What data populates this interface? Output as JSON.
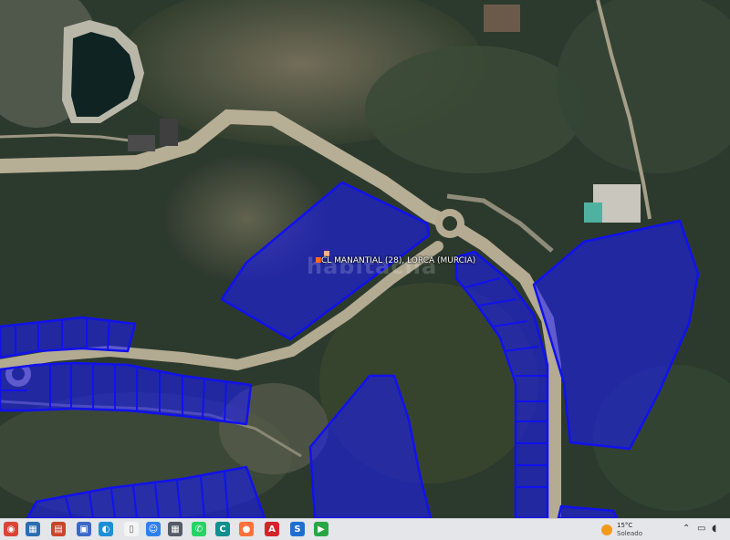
{
  "map": {
    "plot_label": "CL MANANTIAL (28), LORCA (MURCIA)",
    "watermark": "habitaclia",
    "overlay_color": "#1a1aff",
    "overlay_stroke": "#1111ee",
    "marker_colors": [
      "#ff6a1a",
      "#ffb089"
    ]
  },
  "taskbar": {
    "icons": [
      {
        "name": "chrome-icon",
        "color": "#db4437",
        "glyph": "◉"
      },
      {
        "name": "calendar-icon",
        "color": "#2b6cb0",
        "glyph": "▦"
      },
      {
        "name": "slides-icon",
        "color": "#c8462c",
        "glyph": "▤"
      },
      {
        "name": "teams-icon",
        "color": "#3a68c7",
        "glyph": "▣"
      },
      {
        "name": "edge-icon",
        "color": "#1d8fd6",
        "glyph": "◐"
      },
      {
        "name": "file-icon",
        "color": "#f4f4f4",
        "glyph": "▯"
      },
      {
        "name": "finder-icon",
        "color": "#2f80ed",
        "glyph": "☺"
      },
      {
        "name": "store-icon",
        "color": "#555b66",
        "glyph": "▦"
      },
      {
        "name": "whatsapp-icon",
        "color": "#25d366",
        "glyph": "✆"
      },
      {
        "name": "app-icon",
        "color": "#0f8f8f",
        "glyph": "C"
      },
      {
        "name": "firefox-icon",
        "color": "#ff7139",
        "glyph": "●"
      },
      {
        "name": "acrobat-icon",
        "color": "#d5232a",
        "glyph": "A"
      },
      {
        "name": "app2-icon",
        "color": "#1f6fd1",
        "glyph": "S"
      },
      {
        "name": "app3-icon",
        "color": "#27a844",
        "glyph": "▶"
      }
    ],
    "weather": {
      "temperature": "15°C",
      "condition": "Soleado"
    }
  }
}
